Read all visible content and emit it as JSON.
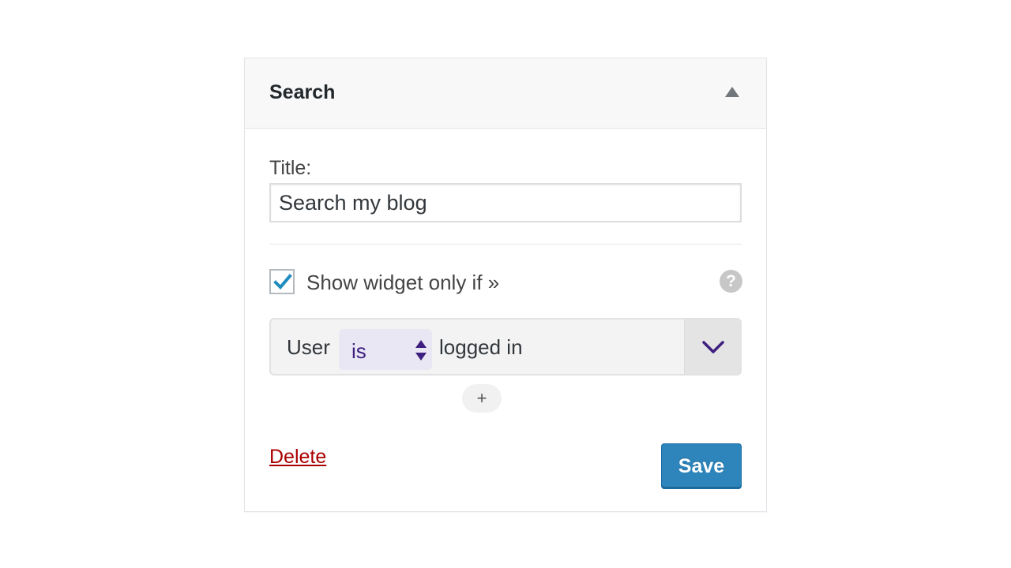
{
  "widget": {
    "title": "Search"
  },
  "form": {
    "title_label": "Title:",
    "title_value": "Search my blog",
    "visibility_checkbox_checked": true,
    "visibility_label": "Show widget only if »",
    "help_glyph": "?"
  },
  "rule": {
    "subject": "User",
    "operator": "is",
    "value": "logged in",
    "add_label": "+"
  },
  "actions": {
    "delete_label": "Delete",
    "save_label": "Save"
  },
  "colors": {
    "accent": "#2e85bb",
    "delete": "#a00000",
    "checkmark": "#1e8cbe",
    "operator_text": "#3e1f80"
  },
  "icons": {
    "collapse": "triangle-up-icon",
    "help": "help-circle-icon",
    "check": "checkmark-icon",
    "operator_arrows": "up-down-arrows-icon",
    "dropdown": "chevron-down-icon"
  }
}
